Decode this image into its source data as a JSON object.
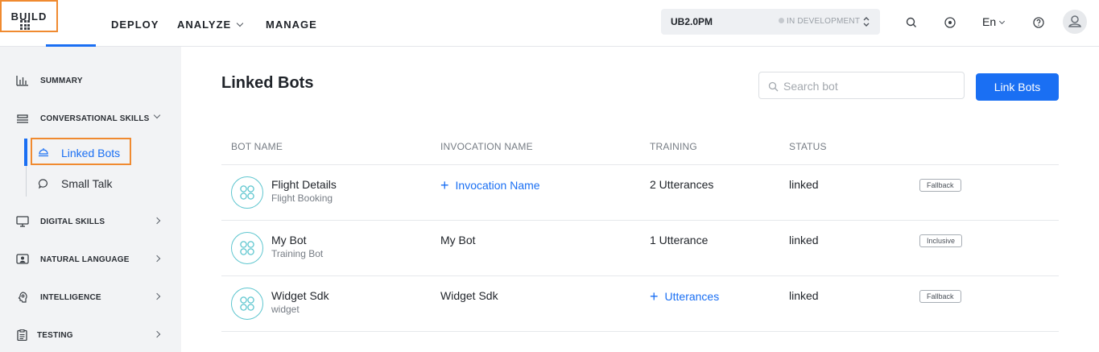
{
  "topnav": {
    "items": [
      "BUILD",
      "DEPLOY",
      "ANALYZE",
      "MANAGE"
    ],
    "app_name": "UB2.0PM",
    "app_status": "IN DEVELOPMENT",
    "language": "En"
  },
  "sidebar": {
    "summary": "SUMMARY",
    "conversational_skills": "CONVERSATIONAL SKILLS",
    "sub_items": [
      "Linked Bots",
      "Small Talk"
    ],
    "digital_skills": "DIGITAL SKILLS",
    "natural_language": "NATURAL LANGUAGE",
    "intelligence": "INTELLIGENCE",
    "testing": "TESTING"
  },
  "main": {
    "title": "Linked Bots",
    "search_placeholder": "Search bot",
    "link_button": "Link Bots",
    "columns": [
      "BOT NAME",
      "INVOCATION NAME",
      "TRAINING",
      "STATUS"
    ],
    "rows": [
      {
        "name": "Flight Details",
        "sub": "Flight Booking",
        "invocation": "Invocation Name",
        "training": "2 Utterances",
        "status": "linked",
        "tag": "Fallback"
      },
      {
        "name": "My Bot",
        "sub": "Training Bot",
        "invocation": "My Bot",
        "training": "1 Utterance",
        "status": "linked",
        "tag": "Inclusive"
      },
      {
        "name": "Widget Sdk",
        "sub": "widget",
        "invocation": "Widget Sdk",
        "training": "Utterances",
        "status": "linked",
        "tag": "Fallback"
      }
    ]
  },
  "colors": {
    "accent": "#1a6ff3",
    "highlight": "#f08a30",
    "bot_icon": "#5ec6cf"
  }
}
